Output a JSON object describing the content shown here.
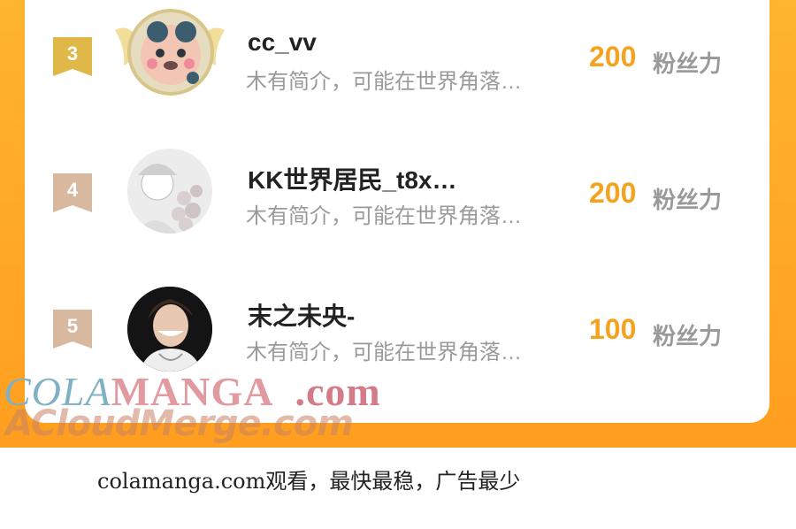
{
  "ranking": [
    {
      "rank": "3",
      "name": "cc_vv",
      "desc": "木有简介，可能在世界角落…",
      "score": "200",
      "unit": "粉丝力",
      "badge_color": "#e0b84a",
      "avatar": "bear-avatar"
    },
    {
      "rank": "4",
      "name": "KK世界居民_t8x…",
      "desc": "木有简介，可能在世界角落…",
      "score": "200",
      "unit": "粉丝力",
      "badge_color": "#d9b8a0",
      "avatar": "anime-avatar"
    },
    {
      "rank": "5",
      "name": "末之未央-",
      "desc": "木有简介，可能在世界角落…",
      "score": "100",
      "unit": "粉丝力",
      "badge_color": "#d9b8a0",
      "avatar": "photo-avatar"
    }
  ],
  "watermark": {
    "line1_a": "COLA",
    "line1_b": "MANGA",
    "line1_c": ".com",
    "line2": "ACloudMerge.com"
  },
  "footer": {
    "text": "colamanga.com观看，最快最稳，广告最少"
  },
  "colors": {
    "frame": "#ff9e1f",
    "score": "#f4a320",
    "gold_badge": "#e0b84a",
    "bronze_badge": "#d9b8a0"
  }
}
